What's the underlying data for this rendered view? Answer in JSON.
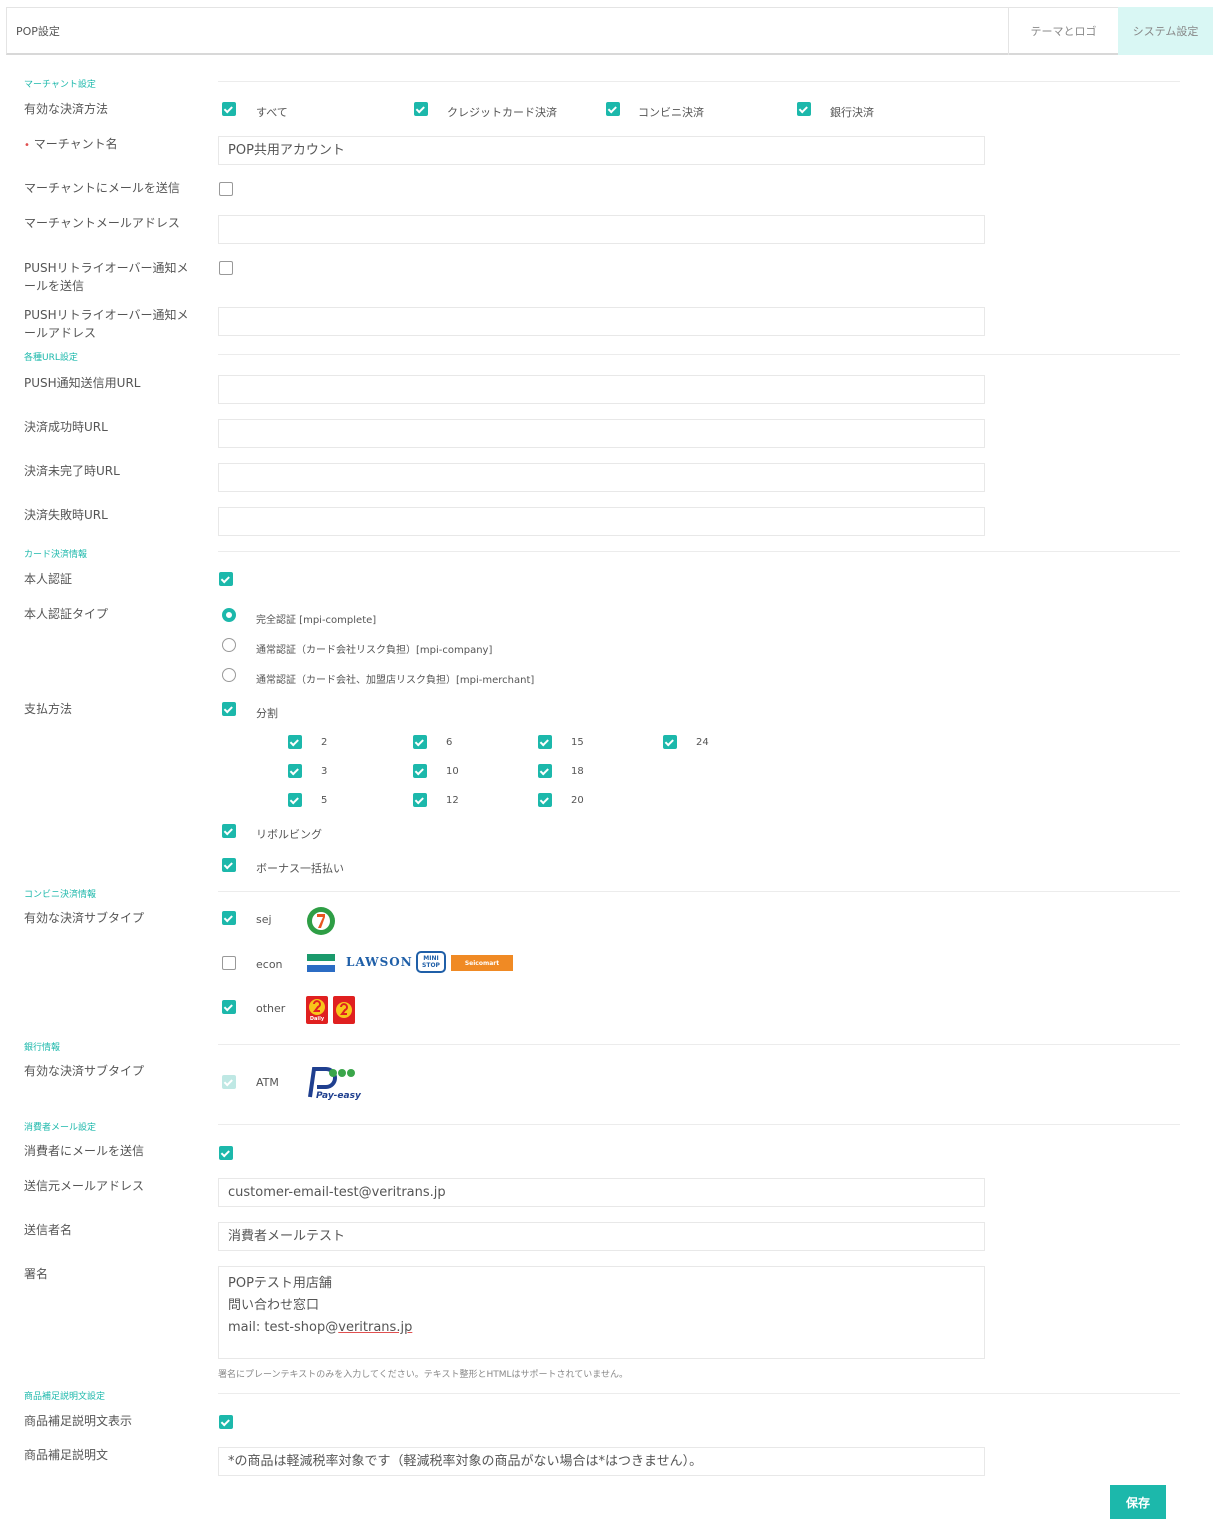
{
  "header": {
    "title": "POP設定",
    "tab_theme": "テーマとロゴ",
    "tab_system": "システム設定"
  },
  "merchant": {
    "section": "マーチャント設定",
    "payment_methods_label": "有効な決済方法",
    "payment_methods": [
      "すべて",
      "クレジットカード決済",
      "コンビニ決済",
      "銀行決済"
    ],
    "required_mark": "•",
    "merchant_name_label": "マーチャント名",
    "merchant_name_value": "POP共用アカウント",
    "send_mail_label": "マーチャントにメールを送信",
    "mail_address_label": "マーチャントメールアドレス",
    "push_retry_send_label_1": "PUSHリトライオーバー通知メ",
    "push_retry_send_label_2": "ールを送信",
    "push_retry_address_label_1": "PUSHリトライオーバー通知メ",
    "push_retry_address_label_2": "ールアドレス"
  },
  "urls": {
    "section": "各種URL設定",
    "push_url_label": "PUSH通知送信用URL",
    "success_url_label": "決済成功時URL",
    "incomplete_url_label": "決済未完了時URL",
    "failure_url_label": "決済失敗時URL"
  },
  "card": {
    "section": "カード決済情報",
    "auth_label": "本人認証",
    "auth_type_label": "本人認証タイプ",
    "auth_types": [
      "完全認証 [mpi-complete]",
      "通常認証（カード会社リスク負担）[mpi-company]",
      "通常認証（カード会社、加盟店リスク負担）[mpi-merchant]"
    ],
    "pay_method_label": "支払方法",
    "installment_label": "分割",
    "installments": [
      "2",
      "6",
      "15",
      "24",
      "3",
      "10",
      "18",
      "5",
      "12",
      "20"
    ],
    "revolving_label": "リボルビング",
    "bonus_label": "ボーナス一括払い"
  },
  "cvs": {
    "section": "コンビニ決済情報",
    "subtype_label": "有効な決済サブタイプ",
    "sej": "sej",
    "econ": "econ",
    "other": "other",
    "lawson_text": "LAWSON",
    "ministop_text": "MINI STOP",
    "seicomart_text": "Seicomart",
    "daily_text": "Daily"
  },
  "bank": {
    "section": "銀行情報",
    "subtype_label": "有効な決済サブタイプ",
    "atm": "ATM",
    "payeasy_text": "Pay-easy"
  },
  "consumer_mail": {
    "section": "消費者メール設定",
    "send_label": "消費者にメールを送信",
    "from_label": "送信元メールアドレス",
    "from_value": "customer-email-test@veritrans.jp",
    "sender_label": "送信者名",
    "sender_value": "消費者メールテスト",
    "signature_label": "署名",
    "signature_line1": "POPテスト用店舗",
    "signature_line2": "問い合わせ窓口",
    "signature_line3_prefix": "mail: test-shop@",
    "signature_line3_link": "veritrans.jp",
    "signature_hint": "署名にプレーンテキストのみを入力してください。テキスト整形とHTMLはサポートされていません。"
  },
  "product_note": {
    "section": "商品補足説明文設定",
    "show_label": "商品補足説明文表示",
    "text_label": "商品補足説明文",
    "text_value": "*の商品は軽減税率対象です（軽減税率対象の商品がない場合は*はつきません）。"
  },
  "save_label": "保存",
  "colors": {
    "accent": "#1cb8ab",
    "active_tab": "#d9f7f4"
  }
}
